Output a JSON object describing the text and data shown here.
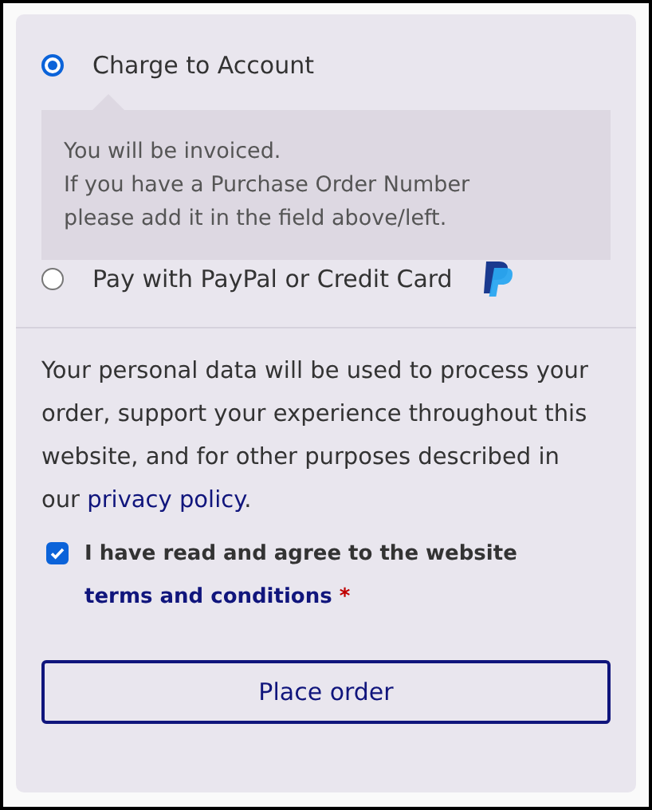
{
  "payment_methods": [
    {
      "label": "Charge to Account",
      "selected": true,
      "description": [
        "You will be invoiced.",
        "If you have a Purchase Order Number",
        "please add it in the field above/left."
      ]
    },
    {
      "label": "Pay with PayPal or Credit Card",
      "selected": false,
      "kind": "paypal"
    }
  ],
  "privacy_notice": {
    "text": "Your personal data will be used to process your order, support your experience throughout this website, and for other purposes described in our",
    "link": "privacy policy",
    "after": "."
  },
  "terms": {
    "checked": true,
    "text": "I have read and agree to the website",
    "link": "terms and conditions",
    "required_mark": "*"
  },
  "button": "Place order"
}
